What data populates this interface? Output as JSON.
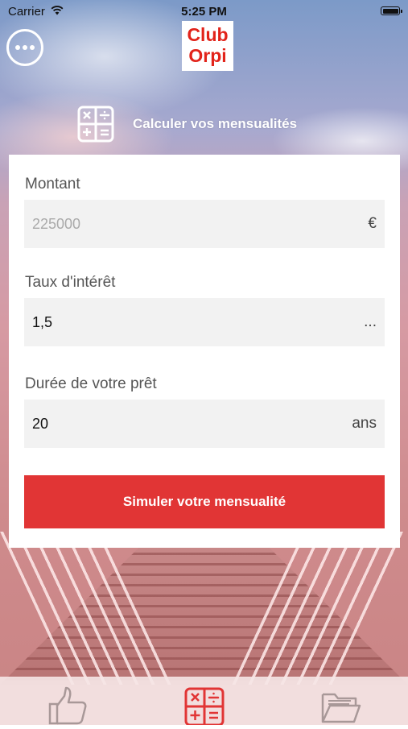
{
  "status_bar": {
    "carrier": "Carrier",
    "time": "5:25 PM"
  },
  "header": {
    "logo_line1": "Club",
    "logo_line2": "Orpi",
    "title": "Calculer vos mensualités"
  },
  "form": {
    "amount": {
      "label": "Montant",
      "placeholder": "225000",
      "unit": "€"
    },
    "rate": {
      "label": "Taux d'intérêt",
      "value": "1,5",
      "unit": "..."
    },
    "duration": {
      "label": "Durée de votre prêt",
      "value": "20",
      "unit": "ans"
    },
    "submit_label": "Simuler votre mensualité"
  },
  "tabbar": {
    "items": [
      {
        "icon": "thumbs-up-icon"
      },
      {
        "icon": "calculator-icon",
        "active": true
      },
      {
        "icon": "folder-icon"
      }
    ]
  },
  "colors": {
    "brand_red": "#e13535",
    "logo_red": "#e2231a"
  }
}
